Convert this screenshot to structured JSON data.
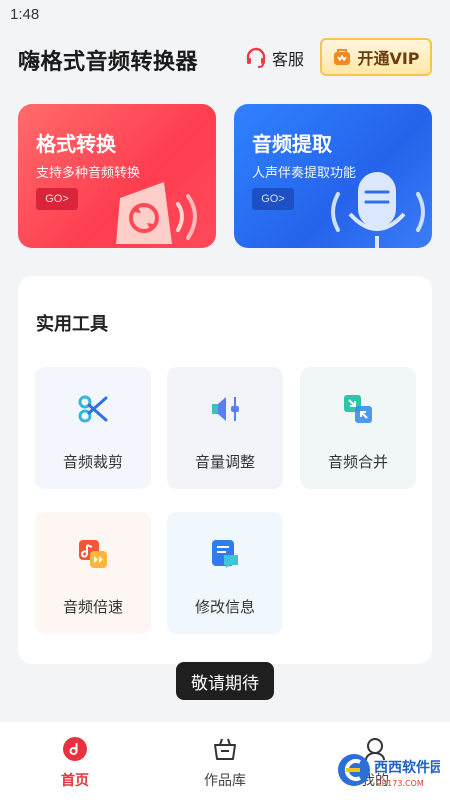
{
  "status_bar": {
    "time": "1:48"
  },
  "header": {
    "title": "嗨格式音频转换器",
    "service_label": "客服",
    "vip_label": "开通VIP"
  },
  "feature_cards": [
    {
      "title": "格式转换",
      "subtitle": "支持多种音频转换",
      "go_label": "GO>",
      "icon": "refresh-speaker-icon"
    },
    {
      "title": "音频提取",
      "subtitle": "人声伴奏提取功能",
      "go_label": "GO>",
      "icon": "microphone-icon"
    }
  ],
  "tools": {
    "title": "实用工具",
    "items": [
      {
        "label": "音频裁剪",
        "icon": "scissors-icon"
      },
      {
        "label": "音量调整",
        "icon": "volume-adjust-icon"
      },
      {
        "label": "音频合并",
        "icon": "merge-icon"
      },
      {
        "label": "音频倍速",
        "icon": "speed-icon"
      },
      {
        "label": "修改信息",
        "icon": "edit-info-icon"
      }
    ]
  },
  "toast": "敬请期待",
  "bottom_nav": {
    "items": [
      {
        "label": "首页",
        "icon": "home-icon",
        "active": true
      },
      {
        "label": "作品库",
        "icon": "library-icon",
        "active": false
      },
      {
        "label": "我的",
        "icon": "profile-icon",
        "active": false
      }
    ]
  },
  "watermark": {
    "text": "西西软件园",
    "sub": "CR173.COM"
  },
  "colors": {
    "accent_red": "#ff3d4f",
    "accent_blue": "#2563eb",
    "vip_gold": "#f5c451"
  }
}
